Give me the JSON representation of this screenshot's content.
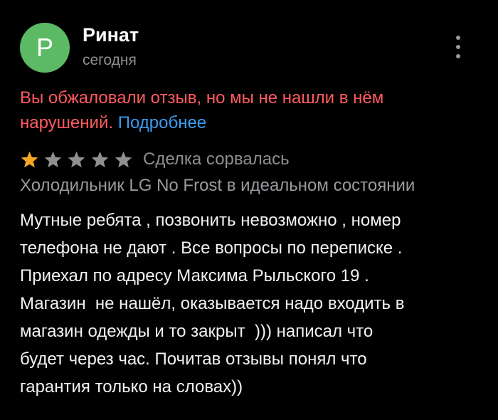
{
  "review": {
    "author": {
      "avatar_letter": "Р",
      "avatar_color": "#5cba64",
      "name": "Ринат"
    },
    "date": "сегодня",
    "menu_icon": "more-vertical-icon",
    "notice": {
      "text": "Вы обжаловали отзыв, но мы не нашли в нём нарушений.",
      "link": "Подробнее",
      "text_color": "#ff5a5f",
      "link_color": "#3a9cf0"
    },
    "rating": {
      "value": 1,
      "max": 5,
      "filled_color": "#f5a623",
      "empty_color": "#8e8e93",
      "status": "Сделка сорвалась"
    },
    "product": "Холодильник LG No Frost в идеальном состоянии",
    "text": "Мутные ребята , позвонить невозможно , номер\nтелефона не дают . Все вопросы по переписке .\nПриехал по адресу Максима Рыльского 19 .\nМагазин  не нашёл, оказывается надо входить в\nмагазин одежды и то закрыт  ))) написал что\nбудет через час. Почитав отзывы понял что\nгарантия только на словах))"
  }
}
